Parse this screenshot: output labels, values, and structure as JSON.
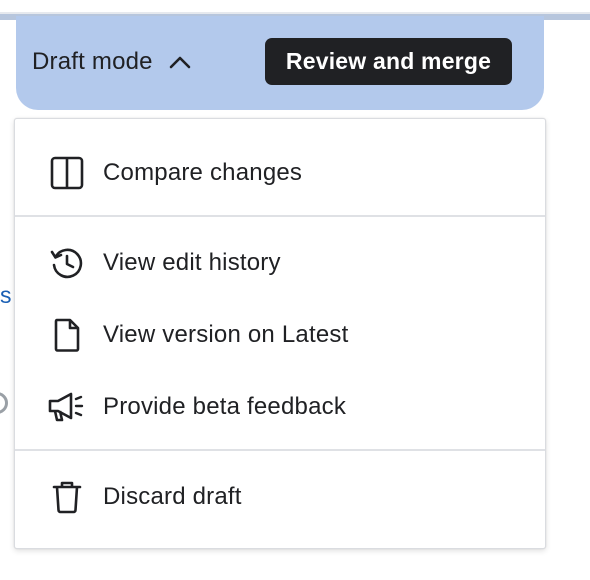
{
  "draft_bar": {
    "mode_label": "Draft mode",
    "mode_icon": "chevron-up-icon",
    "review_button_label": "Review and merge",
    "bar_color": "#b3c9ec",
    "button_color": "#202124"
  },
  "background": {
    "side_link_text": "s"
  },
  "menu": {
    "items": [
      {
        "label": "Compare changes",
        "icon": "compare-columns-icon"
      },
      {
        "label": "View edit history",
        "icon": "history-icon"
      },
      {
        "label": "View version on Latest",
        "icon": "document-icon"
      },
      {
        "label": "Provide beta feedback",
        "icon": "megaphone-icon"
      },
      {
        "label": "Discard draft",
        "icon": "trash-icon"
      }
    ]
  }
}
